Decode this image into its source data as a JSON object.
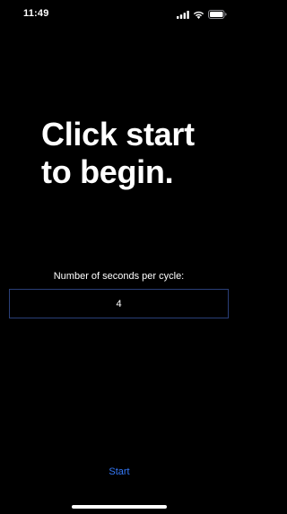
{
  "status_bar": {
    "time": "11:49",
    "icons": [
      "cellular-signal-icon",
      "wifi-icon",
      "battery-icon"
    ]
  },
  "main": {
    "headline": "Click start to begin.",
    "seconds_label": "Number of seconds per cycle:",
    "seconds_value": "4",
    "start_label": "Start"
  },
  "colors": {
    "background": "#000000",
    "text": "#ffffff",
    "accent": "#3478f6",
    "input_border": "#2a3f78"
  }
}
